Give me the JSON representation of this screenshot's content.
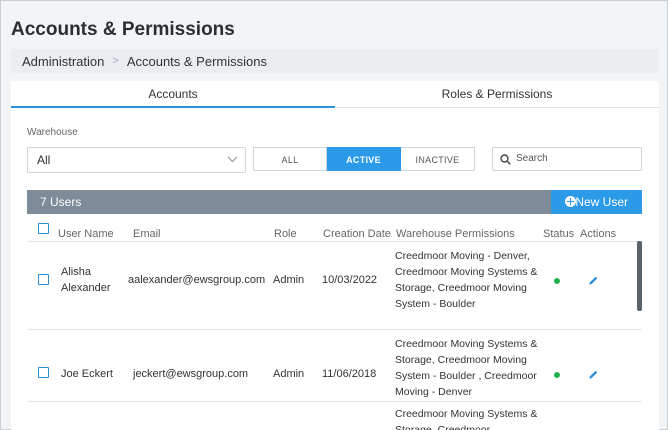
{
  "page": {
    "title": "Accounts & Permissions"
  },
  "breadcrumb": {
    "root": "Administration",
    "current": "Accounts & Permissions"
  },
  "tabs": [
    {
      "label": "Accounts",
      "active": true
    },
    {
      "label": "Roles & Permissions",
      "active": false
    }
  ],
  "filters": {
    "warehouse_label": "Warehouse",
    "warehouse_value": "All",
    "status_options": [
      {
        "label": "ALL",
        "selected": false
      },
      {
        "label": "ACTIVE",
        "selected": true
      },
      {
        "label": "INACTIVE",
        "selected": false
      }
    ],
    "search_placeholder": "Search"
  },
  "list": {
    "count_label": "7 Users",
    "new_user_label": "New User",
    "columns": {
      "name": "User Name",
      "email": "Email",
      "role": "Role",
      "created": "Creation Date",
      "permissions": "Warehouse Permissions",
      "status": "Status",
      "actions": "Actions"
    },
    "rows": [
      {
        "name_line1": "Alisha",
        "name_line2": "Alexander",
        "email": "aalexander@ewsgroup.com",
        "role": "Admin",
        "created": "10/03/2022",
        "permissions": "Creedmoor Moving - Denver, Creedmoor Moving Systems & Storage, Creedmoor Moving System - Boulder",
        "status": "active"
      },
      {
        "name_line1": "Joe Eckert",
        "name_line2": "",
        "email": "jeckert@ewsgroup.com",
        "role": "Admin",
        "created": "11/06/2018",
        "permissions": "Creedmoor Moving Systems & Storage, Creedmoor Moving System - Boulder , Creedmoor Moving - Denver",
        "status": "active"
      },
      {
        "name_line1": "",
        "name_line2": "",
        "email": "",
        "role": "",
        "created": "",
        "permissions": "Creedmoor Moving Systems & Storage, Creedmoor",
        "status": ""
      }
    ]
  },
  "colors": {
    "accent": "#2b9ae8",
    "header_bar": "#7e8b98",
    "status_active": "#22b14c"
  },
  "icons": {
    "chevron": "chevron-down-icon",
    "search": "search-icon",
    "add": "plus-circle-icon",
    "edit": "pencil-icon"
  }
}
